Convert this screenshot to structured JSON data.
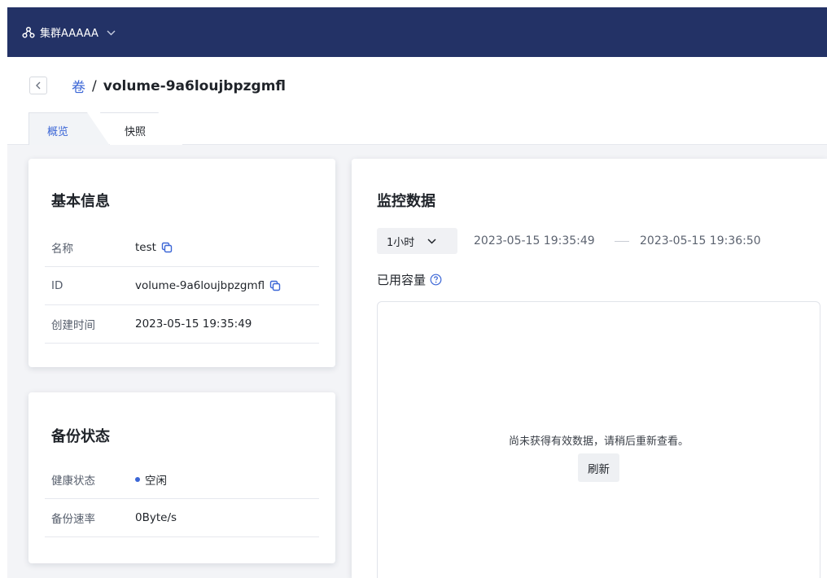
{
  "topbar": {
    "cluster_icon": "cluster-icon",
    "cluster_name": "集群AAAAA",
    "dropdown_icon": "chevron-down-icon",
    "background_color": "#233266"
  },
  "breadcrumb": {
    "back_icon": "chevron-left-icon",
    "parent": "卷",
    "separator": "/",
    "current": "volume-9a6loujbpzgmfl"
  },
  "tabs": [
    {
      "label": "概览",
      "active": true
    },
    {
      "label": "快照",
      "active": false
    }
  ],
  "basic_info": {
    "title": "基本信息",
    "rows": [
      {
        "key": "名称",
        "value": "test",
        "copy": true
      },
      {
        "key": "ID",
        "value": "volume-9a6loujbpzgmfl",
        "copy": true
      },
      {
        "key": "创建时间",
        "value": "2023-05-15 19:35:49",
        "copy": false
      }
    ]
  },
  "backup_status": {
    "title": "备份状态",
    "rows": [
      {
        "key": "健康状态",
        "value": "空闲",
        "status_dot": true
      },
      {
        "key": "备份速率",
        "value": "0Byte/s"
      }
    ]
  },
  "monitor": {
    "title": "监控数据",
    "range_selected": "1小时",
    "time_start": "2023-05-15 19:35:49",
    "time_end": "2023-05-15 19:36:50",
    "usage_label": "已用容量",
    "help_icon": "help-circle-icon",
    "empty_message": "尚未获得有效数据，请稍后重新查看。",
    "refresh_label": "刷新"
  },
  "colors": {
    "accent": "#3b66d6",
    "nav": "#233266",
    "content_bg": "#f3f4f7"
  }
}
